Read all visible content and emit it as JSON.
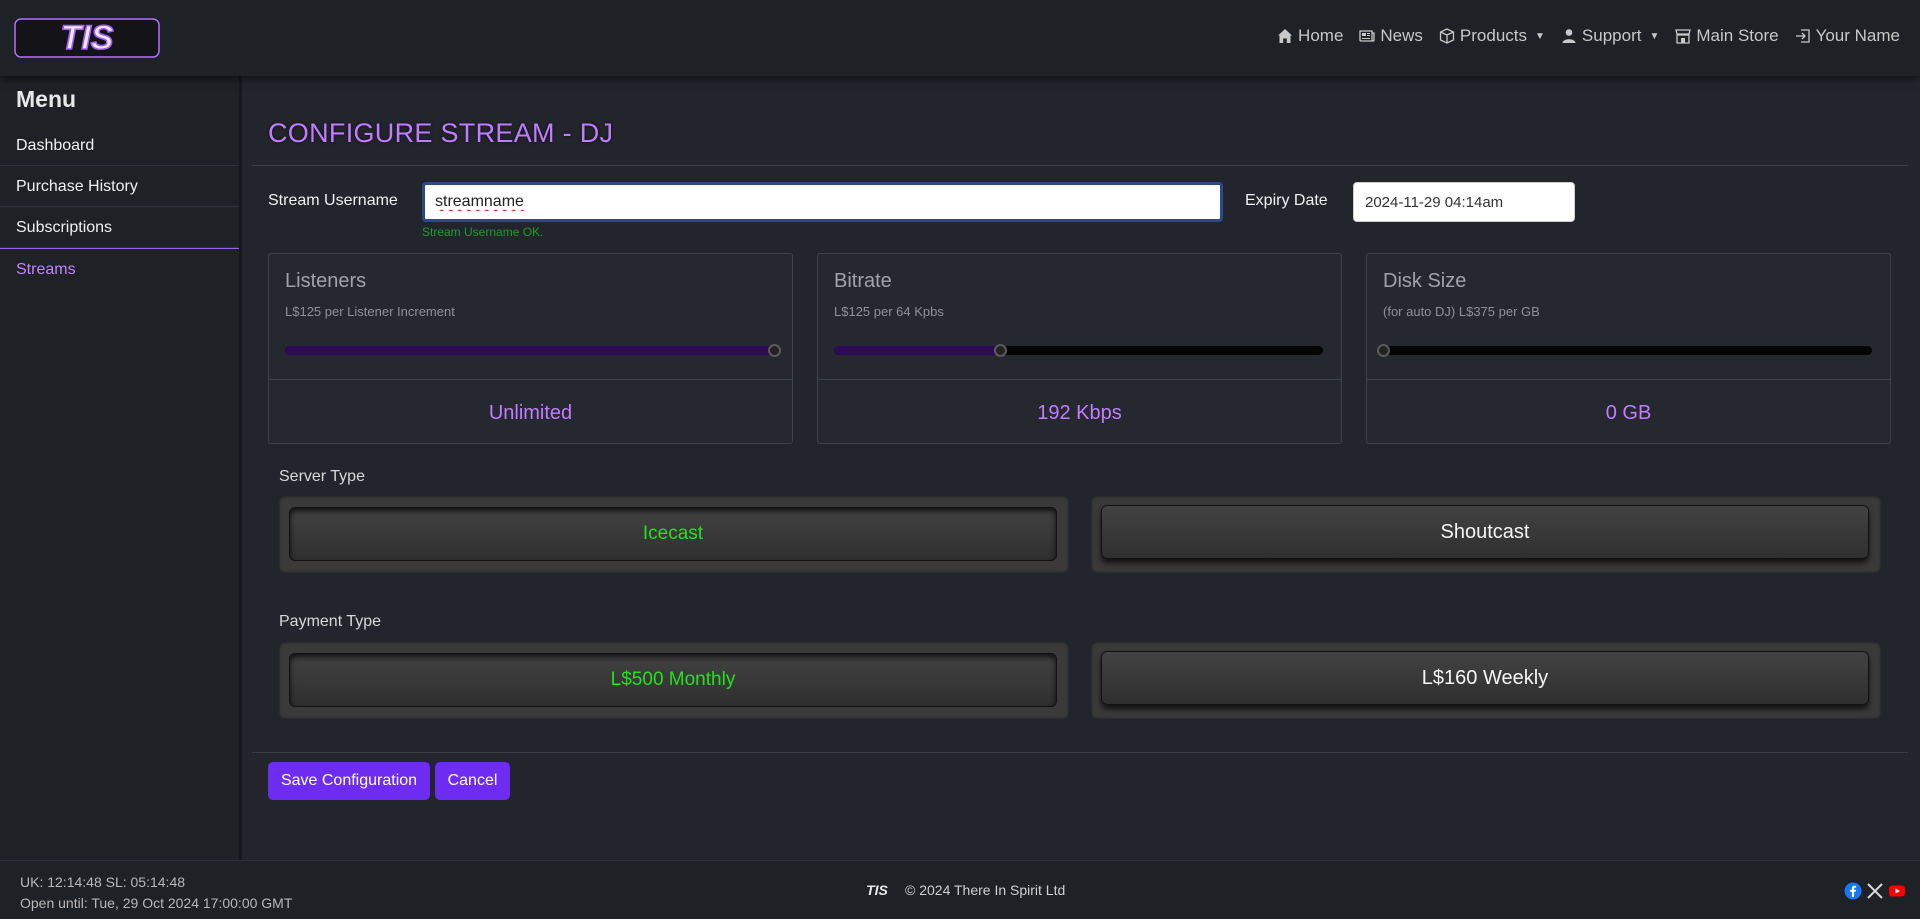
{
  "brand": {
    "logo_text": "TIS",
    "logo_color": "#c07cff"
  },
  "nav": {
    "items": [
      {
        "label": "Home",
        "icon": "home-icon"
      },
      {
        "label": "News",
        "icon": "newspaper-icon"
      },
      {
        "label": "Products",
        "icon": "box-icon",
        "dropdown": true
      },
      {
        "label": "Support",
        "icon": "person-icon",
        "dropdown": true
      },
      {
        "label": "Main Store",
        "icon": "store-icon"
      },
      {
        "label": "Your Name",
        "icon": "login-icon"
      }
    ]
  },
  "sidebar": {
    "title": "Menu",
    "items": [
      {
        "label": "Dashboard"
      },
      {
        "label": "Purchase History"
      },
      {
        "label": "Subscriptions"
      },
      {
        "label": "Streams",
        "active": true
      }
    ]
  },
  "main": {
    "title": "CONFIGURE STREAM - DJ",
    "username_label": "Stream Username",
    "username_value": "streamname",
    "username_status": "Stream Username OK.",
    "expiry_label": "Expiry Date",
    "expiry_value": "2024-11-29 04:14am",
    "cards": [
      {
        "title": "Listeners",
        "subtitle": "L$125 per Listener Increment",
        "value": "Unlimited",
        "slider_percent": 100
      },
      {
        "title": "Bitrate",
        "subtitle": "L$125 per 64 Kpbs",
        "value": "192 Kbps",
        "slider_percent": 34
      },
      {
        "title": "Disk Size",
        "subtitle": "(for auto DJ) L$375 per GB",
        "value": "0 GB",
        "slider_percent": 0
      }
    ],
    "server_type": {
      "label": "Server Type",
      "options": [
        {
          "label": "Icecast",
          "selected": true
        },
        {
          "label": "Shoutcast",
          "selected": false
        }
      ]
    },
    "payment_type": {
      "label": "Payment Type",
      "options": [
        {
          "label": "L$500 Monthly",
          "selected": true
        },
        {
          "label": "L$160 Weekly",
          "selected": false
        }
      ]
    },
    "save_label": "Save Configuration",
    "cancel_label": "Cancel"
  },
  "footer": {
    "time_line": "UK: 12:14:48 SL: 05:14:48",
    "open_line": "Open until: Tue, 29 Oct 2024 17:00:00 GMT",
    "logo_text": "TIS",
    "copyright": "© 2024 There In Spirit Ltd",
    "social": [
      "facebook-icon",
      "x-icon",
      "youtube-icon"
    ]
  },
  "colors": {
    "accent": "#6e2cf0",
    "title_purple": "#c07cff",
    "selected_green": "#22e31c",
    "ok_green": "#1f9d2a"
  }
}
